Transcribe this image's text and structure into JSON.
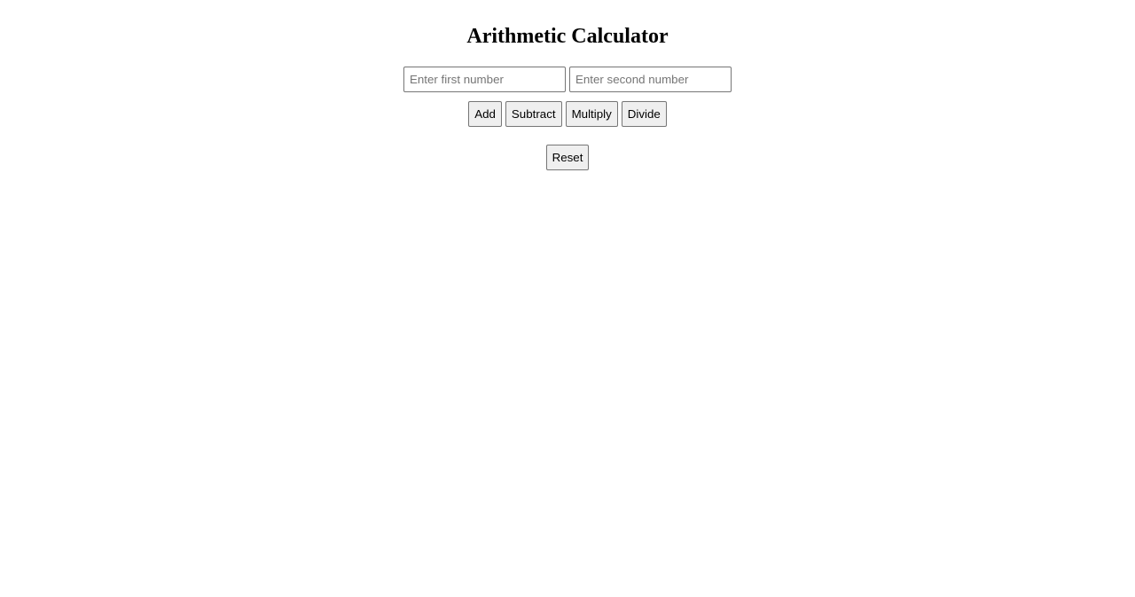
{
  "title": "Arithmetic Calculator",
  "inputs": {
    "first": {
      "placeholder": "Enter first number",
      "value": ""
    },
    "second": {
      "placeholder": "Enter second number",
      "value": ""
    }
  },
  "operations": {
    "add": "Add",
    "subtract": "Subtract",
    "multiply": "Multiply",
    "divide": "Divide"
  },
  "reset_label": "Reset"
}
